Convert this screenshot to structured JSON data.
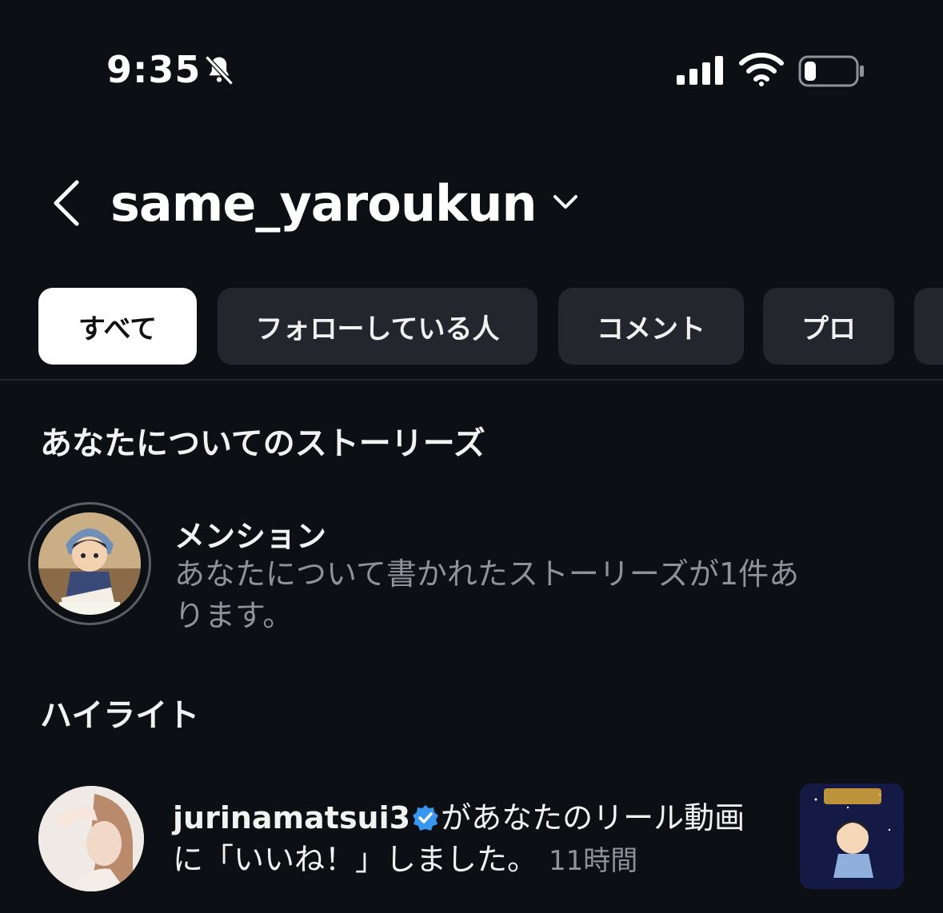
{
  "status_bar": {
    "time": "9:35",
    "icons": [
      "bell-slash-icon",
      "cellular-signal-icon",
      "wifi-icon",
      "battery-icon"
    ]
  },
  "header": {
    "username": "same_yaroukun",
    "icons": [
      "back-chevron-icon",
      "chevron-down-icon"
    ]
  },
  "tabs": [
    {
      "label": "すべて",
      "active": true
    },
    {
      "label": "フォローしている人",
      "active": false
    },
    {
      "label": "コメント",
      "active": false
    },
    {
      "label": "プロ",
      "active": false
    },
    {
      "label": "",
      "active": false
    }
  ],
  "stories_section": {
    "title": "あなたについてのストーリーズ",
    "mention": {
      "title": "メンション",
      "description": "あなたについて書かれたストーリーズが1件あります。"
    }
  },
  "highlights_section": {
    "title": "ハイライト",
    "notification": {
      "username": "jurinamatsui3",
      "verified": true,
      "message": "があなたのリール動画に「いいね！」しました。",
      "time_ago": "11時間"
    }
  },
  "colors": {
    "background": "#0c0f14",
    "tab_inactive": "#23262c",
    "tab_active": "#ffffff",
    "secondary_text": "#8e9299",
    "verified_blue": "#3897f0"
  }
}
